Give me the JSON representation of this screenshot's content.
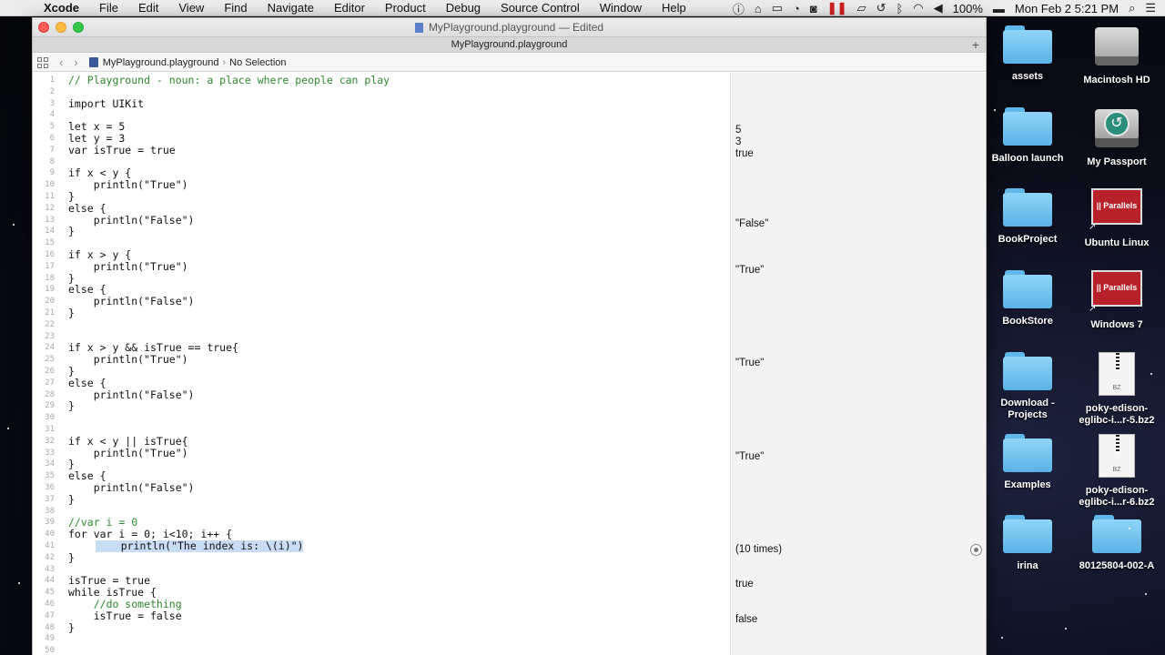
{
  "menubar": {
    "apple": "",
    "items": [
      "Xcode",
      "File",
      "Edit",
      "View",
      "Find",
      "Navigate",
      "Editor",
      "Product",
      "Debug",
      "Source Control",
      "Window",
      "Help"
    ],
    "status_icons": [
      "info-icon",
      "home-icon",
      "screen-icon",
      "bell-icon",
      "chat-icon",
      "pause-icon",
      "airplay-icon",
      "time-machine-icon",
      "bluetooth-icon",
      "wifi-icon",
      "volume-icon"
    ],
    "battery": "100%",
    "clock": "Mon Feb 2  5:21 PM"
  },
  "window": {
    "title": "MyPlayground.playground — Edited",
    "tab_title": "MyPlayground.playground",
    "jumpbar": {
      "file": "MyPlayground.playground",
      "selection": "No Selection"
    }
  },
  "editor": {
    "lines": [
      {
        "n": "1",
        "code": "// Playground - noun: a place where people can play",
        "type": "comment"
      },
      {
        "n": "2",
        "code": "",
        "type": "code"
      },
      {
        "n": "3",
        "code": "import UIKit",
        "type": "code"
      },
      {
        "n": "4",
        "code": "",
        "type": "code"
      },
      {
        "n": "5",
        "code": "let x = 5",
        "type": "code"
      },
      {
        "n": "6",
        "code": "let y = 3",
        "type": "code"
      },
      {
        "n": "7",
        "code": "var isTrue = true",
        "type": "code"
      },
      {
        "n": "8",
        "code": "",
        "type": "code"
      },
      {
        "n": "9",
        "code": "if x < y {",
        "type": "code"
      },
      {
        "n": "10",
        "code": "    println(\"True\")",
        "type": "code"
      },
      {
        "n": "11",
        "code": "}",
        "type": "code"
      },
      {
        "n": "12",
        "code": "else {",
        "type": "code"
      },
      {
        "n": "13",
        "code": "    println(\"False\")",
        "type": "code"
      },
      {
        "n": "14",
        "code": "}",
        "type": "code"
      },
      {
        "n": "15",
        "code": "",
        "type": "code"
      },
      {
        "n": "16",
        "code": "if x > y {",
        "type": "code"
      },
      {
        "n": "17",
        "code": "    println(\"True\")",
        "type": "code"
      },
      {
        "n": "18",
        "code": "}",
        "type": "code"
      },
      {
        "n": "19",
        "code": "else {",
        "type": "code"
      },
      {
        "n": "20",
        "code": "    println(\"False\")",
        "type": "code"
      },
      {
        "n": "21",
        "code": "}",
        "type": "code"
      },
      {
        "n": "22",
        "code": "",
        "type": "code"
      },
      {
        "n": "23",
        "code": "",
        "type": "code"
      },
      {
        "n": "24",
        "code": "if x > y && isTrue == true{",
        "type": "code"
      },
      {
        "n": "25",
        "code": "    println(\"True\")",
        "type": "code"
      },
      {
        "n": "26",
        "code": "}",
        "type": "code"
      },
      {
        "n": "27",
        "code": "else {",
        "type": "code"
      },
      {
        "n": "28",
        "code": "    println(\"False\")",
        "type": "code"
      },
      {
        "n": "29",
        "code": "}",
        "type": "code"
      },
      {
        "n": "30",
        "code": "",
        "type": "code"
      },
      {
        "n": "31",
        "code": "",
        "type": "code"
      },
      {
        "n": "32",
        "code": "if x < y || isTrue{",
        "type": "code"
      },
      {
        "n": "33",
        "code": "    println(\"True\")",
        "type": "code"
      },
      {
        "n": "34",
        "code": "}",
        "type": "code"
      },
      {
        "n": "35",
        "code": "else {",
        "type": "code"
      },
      {
        "n": "36",
        "code": "    println(\"False\")",
        "type": "code"
      },
      {
        "n": "37",
        "code": "}",
        "type": "code"
      },
      {
        "n": "38",
        "code": "",
        "type": "code"
      },
      {
        "n": "39",
        "code": "//var i = 0",
        "type": "comment"
      },
      {
        "n": "40",
        "code": "for var i = 0; i<10; i++ {",
        "type": "code"
      },
      {
        "n": "41",
        "code": "    println(\"The index is: \\(i)\")",
        "type": "highlight"
      },
      {
        "n": "42",
        "code": "}",
        "type": "code"
      },
      {
        "n": "43",
        "code": "",
        "type": "code"
      },
      {
        "n": "44",
        "code": "isTrue = true",
        "type": "code"
      },
      {
        "n": "45",
        "code": "while isTrue {",
        "type": "code"
      },
      {
        "n": "46",
        "code": "    //do something",
        "type": "comment"
      },
      {
        "n": "47",
        "code": "    isTrue = false",
        "type": "code"
      },
      {
        "n": "48",
        "code": "}",
        "type": "code"
      },
      {
        "n": "49",
        "code": "",
        "type": "code"
      },
      {
        "n": "50",
        "code": "",
        "type": "code"
      }
    ]
  },
  "results": [
    {
      "line": 5,
      "text": "5"
    },
    {
      "line": 6,
      "text": "3"
    },
    {
      "line": 7,
      "text": "true"
    },
    {
      "line": 13,
      "text": "\"False\""
    },
    {
      "line": 17,
      "text": "\"True\""
    },
    {
      "line": 25,
      "text": "\"True\""
    },
    {
      "line": 33,
      "text": "\"True\""
    },
    {
      "line": 41,
      "text": "(10 times)",
      "quick_look": true
    },
    {
      "line": 44,
      "text": "true"
    },
    {
      "line": 47,
      "text": "false"
    }
  ],
  "desktop": [
    {
      "label": "assets",
      "icon": "folder"
    },
    {
      "label": "Macintosh HD",
      "icon": "hard-drive"
    },
    {
      "label": "Balloon launch",
      "icon": "folder"
    },
    {
      "label": "My Passport",
      "icon": "time-machine-drive"
    },
    {
      "label": "BookProject",
      "icon": "folder"
    },
    {
      "label": "Ubuntu Linux",
      "icon": "parallels-vm"
    },
    {
      "label": "BookStore",
      "icon": "folder"
    },
    {
      "label": "Windows 7",
      "icon": "parallels-vm"
    },
    {
      "label": "Download - Projects",
      "icon": "folder"
    },
    {
      "label": "poky-edison-eglibc-i...r-5.bz2",
      "icon": "bz2-archive"
    },
    {
      "label": "Examples",
      "icon": "folder"
    },
    {
      "label": "poky-edison-eglibc-i...r-6.bz2",
      "icon": "bz2-archive"
    },
    {
      "label": "irina",
      "icon": "folder"
    },
    {
      "label": "80125804-002-A",
      "icon": "folder"
    }
  ],
  "parallels_logo": "|| Parallels",
  "bz_label": "BZ"
}
